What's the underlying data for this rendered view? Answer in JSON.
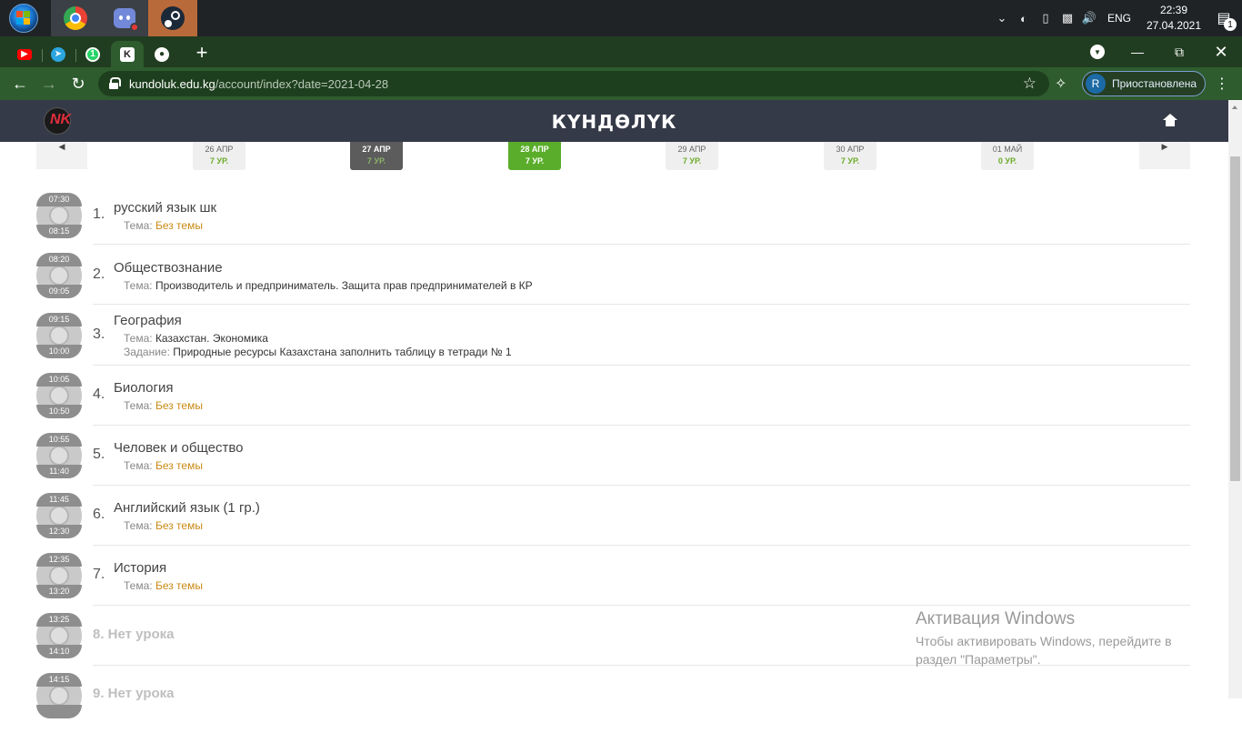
{
  "taskbar": {
    "apps": [
      "Google Chrome",
      "Discord",
      "Steam"
    ],
    "language": "ENG",
    "time": "22:39",
    "date": "27.04.2021",
    "notifications": "1"
  },
  "browser": {
    "pinned_tabs": [
      "youtube-icon",
      "telegram-icon",
      "whatsapp-icon",
      "kundoluk-icon",
      "github-icon"
    ],
    "whatsapp_badge": "1",
    "url_host": "kundoluk.edu.kg",
    "url_path": "/account/index?date=2021-04-28",
    "profile_initial": "R",
    "profile_status": "Приостановлена"
  },
  "site": {
    "brand": "КҮНДӨЛҮК",
    "logo_letters": "NK"
  },
  "dates": [
    {
      "label": "26 АПР",
      "lessons": "7 УР.",
      "state": "normal"
    },
    {
      "label": "27 АПР",
      "lessons": "7 УР.",
      "state": "past"
    },
    {
      "label": "28 АПР",
      "lessons": "7 УР.",
      "state": "today"
    },
    {
      "label": "29 АПР",
      "lessons": "7 УР.",
      "state": "normal"
    },
    {
      "label": "30 АПР",
      "lessons": "7 УР.",
      "state": "normal"
    },
    {
      "label": "01 МАЙ",
      "lessons": "0 УР.",
      "state": "normal"
    }
  ],
  "lessons": [
    {
      "start": "07:30",
      "end": "08:15",
      "num": "1.",
      "subject": "русский язык шк",
      "topic_label": "Тема:",
      "topic": "Без темы",
      "no_topic": true
    },
    {
      "start": "08:20",
      "end": "09:05",
      "num": "2.",
      "subject": "Обществознание",
      "topic_label": "Тема:",
      "topic": "Производитель и предприниматель. Защита прав предпринимателей в КР",
      "no_topic": false
    },
    {
      "start": "09:15",
      "end": "10:00",
      "num": "3.",
      "subject": "География",
      "topic_label": "Тема:",
      "topic": "Казахстан. Экономика",
      "no_topic": false,
      "task_label": "Задание:",
      "task": "Природные ресурсы Казахстана  заполнить таблицу в тетради № 1"
    },
    {
      "start": "10:05",
      "end": "10:50",
      "num": "4.",
      "subject": "Биология",
      "topic_label": "Тема:",
      "topic": "Без темы",
      "no_topic": true
    },
    {
      "start": "10:55",
      "end": "11:40",
      "num": "5.",
      "subject": "Человек и общество",
      "topic_label": "Тема:",
      "topic": "Без темы",
      "no_topic": true
    },
    {
      "start": "11:45",
      "end": "12:30",
      "num": "6.",
      "subject": "Английский язык (1 гр.)",
      "topic_label": "Тема:",
      "topic": "Без темы",
      "no_topic": true
    },
    {
      "start": "12:35",
      "end": "13:20",
      "num": "7.",
      "subject": "История",
      "topic_label": "Тема:",
      "topic": "Без темы",
      "no_topic": true
    },
    {
      "start": "13:25",
      "end": "14:10",
      "num": "8.",
      "empty_text": "8. Нет урока"
    },
    {
      "start": "14:15",
      "end": "",
      "num": "9.",
      "empty_text": "9. Нет урока"
    }
  ],
  "watermark": {
    "title": "Активация Windows",
    "line1": "Чтобы активировать Windows, перейдите в",
    "line2": "раздел \"Параметры\"."
  }
}
